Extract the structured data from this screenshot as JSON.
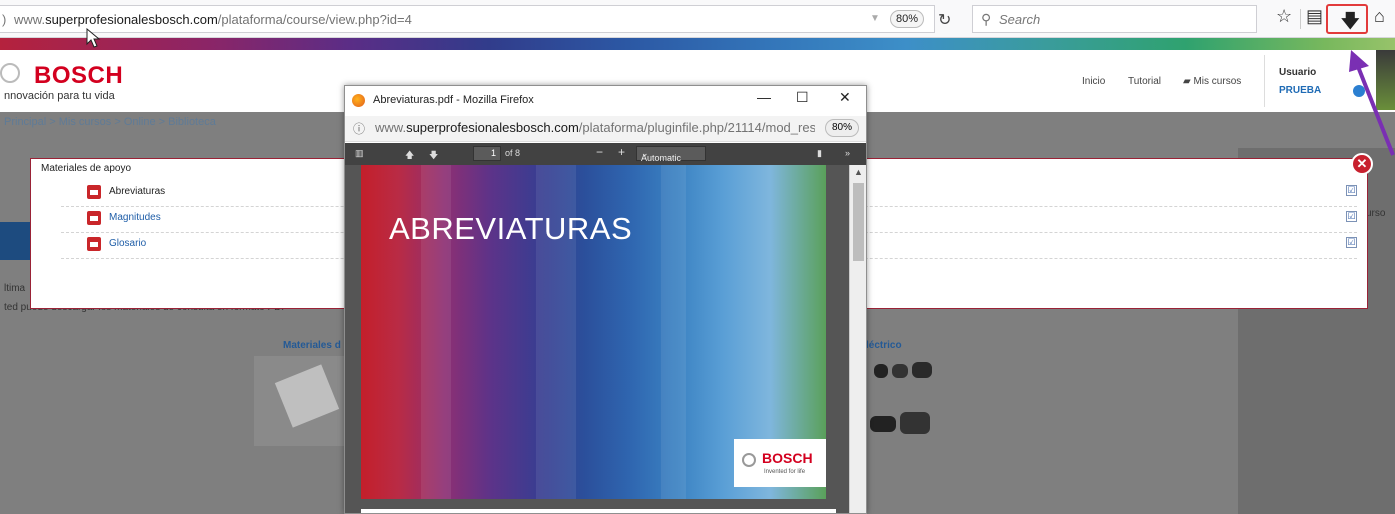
{
  "browser": {
    "url_prefix": "www.",
    "url_domain": "superprofesionalesbosch.com",
    "url_path": "/plataforma/course/view.php?id=4",
    "url_left_char": ")",
    "zoom": "80%",
    "search_placeholder": "Search"
  },
  "header": {
    "brand": "BOSCH",
    "tagline": "nnovación para tu vida",
    "nav": [
      "Inicio",
      "Tutorial",
      "Mis cursos"
    ],
    "user_label": "Usuario",
    "user_name": "PRUEBA"
  },
  "breadcrumb": "Principal  >  Mis cursos  >  Online  >  Biblioteca",
  "background": {
    "right_text": "urso",
    "left_text_1": "ltima",
    "left_text_2": "ted puede descargar los materiales de consulta en formato PDF",
    "card_left": "Materiales d",
    "card_right": "léctrico"
  },
  "modal": {
    "title": "Materiales de apoyo",
    "items": [
      {
        "label": "Abreviaturas",
        "color": "#222222"
      },
      {
        "label": "Magnitudes",
        "color": "#1f5ea8"
      },
      {
        "label": "Glosario",
        "color": "#1f5ea8"
      }
    ],
    "check_glyph": "☑"
  },
  "popup": {
    "window_title": "Abreviaturas.pdf - Mozilla Firefox",
    "url_prefix": "www.",
    "url_domain": "superprofesionalesbosch.com",
    "url_path": "/plataforma/pluginfile.php/21114/mod_res",
    "zoom": "80%",
    "page_number": "1",
    "page_total": "of 8",
    "zoom_select": "Automatic Zoom",
    "pdf_title": "ABREVIATURAS",
    "pdf_brand": "BOSCH",
    "pdf_brand_tag": "Invented for life"
  },
  "colors": {
    "bosch_red": "#d3001f",
    "modal_border": "#9a2236",
    "download_highlight": "#e23b3b",
    "annotation_arrow": "#7a2fb3"
  }
}
